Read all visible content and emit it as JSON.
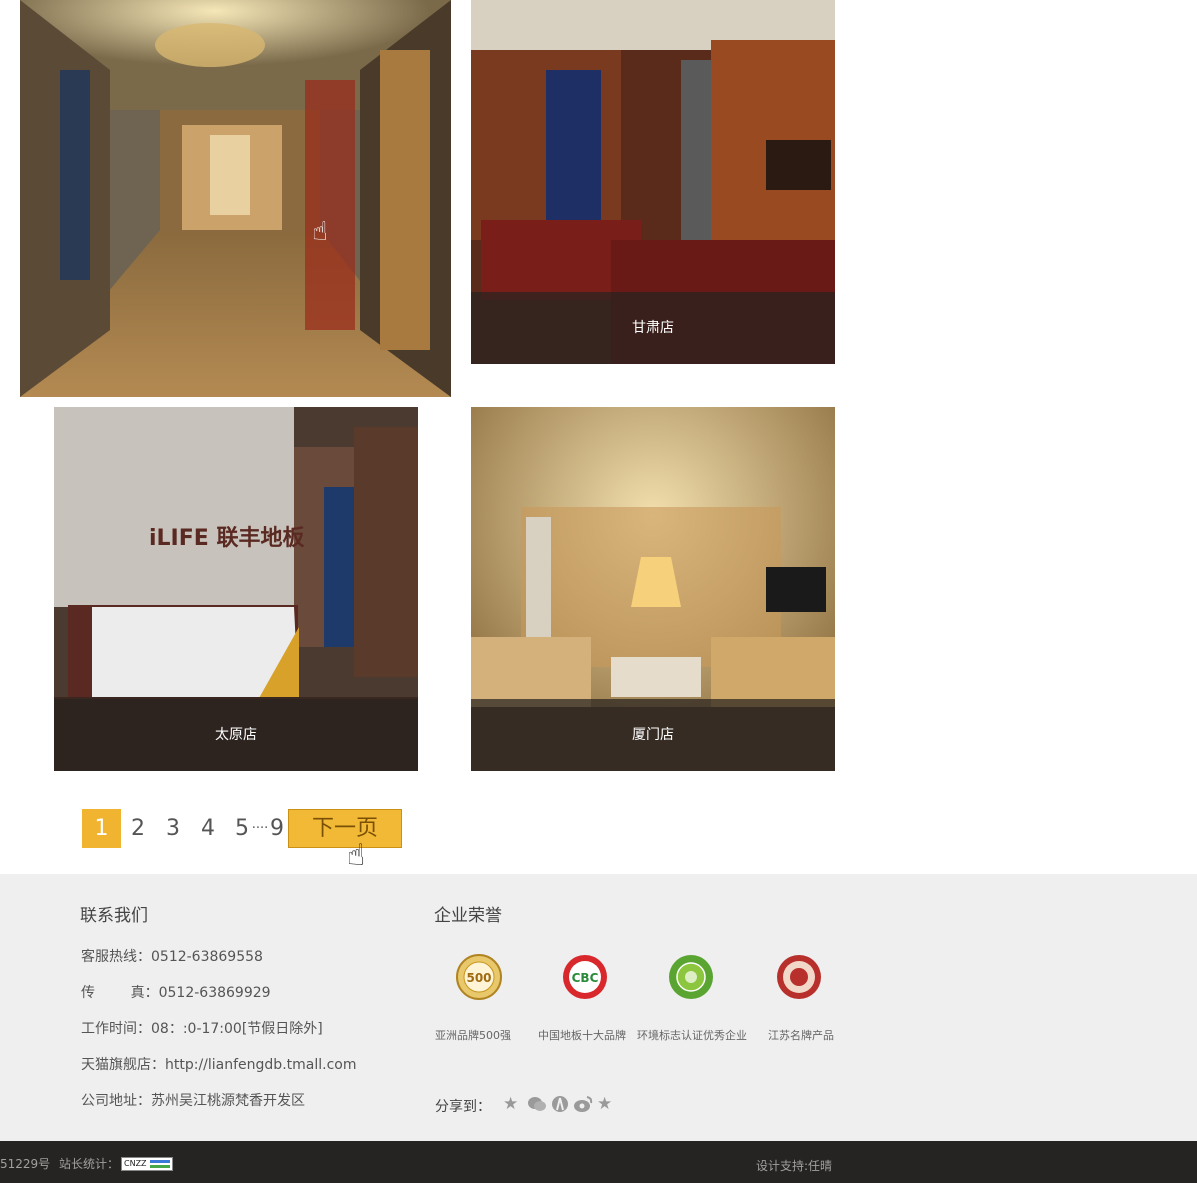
{
  "stores": [
    {
      "name": ""
    },
    {
      "name": "甘肃店"
    },
    {
      "name": "太原店"
    },
    {
      "name": "厦门店"
    }
  ],
  "pagination": {
    "pages": [
      "1",
      "2",
      "3",
      "4",
      "5",
      "····",
      "9"
    ],
    "current": "1",
    "next_label": "下一页"
  },
  "contact": {
    "title": "联系我们",
    "hotline": "客服热线：0512-63869558",
    "fax_label": "传        真：0512-63869929",
    "hours": "工作时间：08：:0-17:00[节假日除外]",
    "tmall": "天猫旗舰店：http://lianfengdb.tmall.com",
    "address": "公司地址：苏州吴江桃源梵香开发区"
  },
  "honors": {
    "title": "企业荣誉",
    "items": [
      {
        "label": "亚洲品牌500强",
        "badge": "500",
        "icon": "asia-500-badge-icon",
        "color": "#c9961e"
      },
      {
        "label": "中国地板十大品牌",
        "badge": "CBC",
        "icon": "cbc-badge-icon",
        "color": "#c8262a"
      },
      {
        "label": "环境标志认证优秀企业",
        "badge": "",
        "icon": "environment-label-badge-icon",
        "color": "#5aa532"
      },
      {
        "label": "江苏名牌产品",
        "badge": "",
        "icon": "jiangsu-brand-badge-icon",
        "color": "#a42a2a"
      }
    ]
  },
  "share": {
    "label": "分享到：",
    "icons": [
      "qzone-icon",
      "wechat-icon",
      "renren-icon",
      "weibo-icon",
      "favorite-icon"
    ]
  },
  "bottom": {
    "icp": "51229号",
    "stats_label": "站长统计：",
    "stats_badge": "CNZZ",
    "design": "设计支持:任晴"
  }
}
